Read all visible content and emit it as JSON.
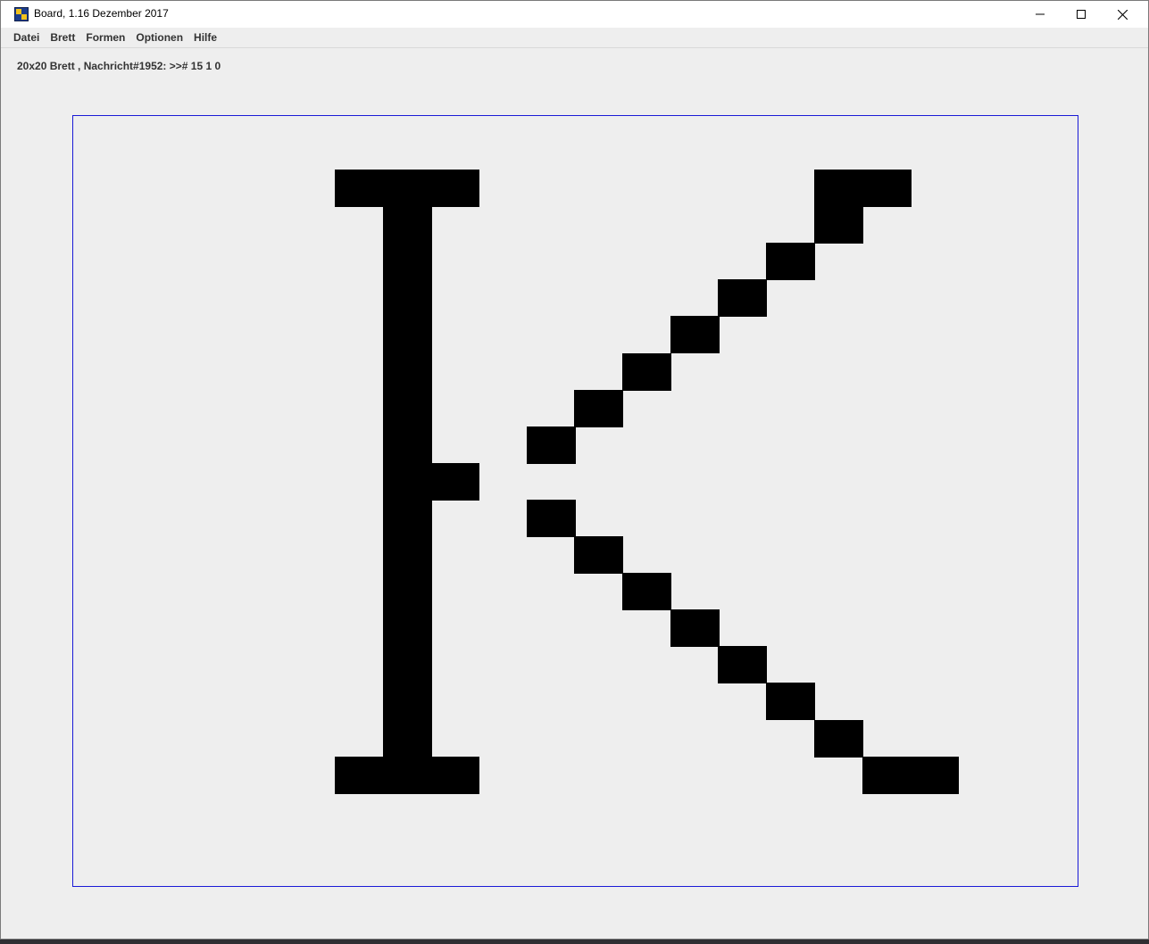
{
  "window": {
    "title": "Board, 1.16 Dezember 2017",
    "icon": "board-app-icon"
  },
  "menu": {
    "items": [
      "Datei",
      "Brett",
      "Formen",
      "Optionen",
      "Hilfe"
    ]
  },
  "status": {
    "text": "20x20 Brett , Nachricht#1952: >># 15 1 0"
  },
  "board": {
    "size": "20x20",
    "border_color": "#1a1ad6",
    "background_color": "#eeeeee",
    "filled_color": "#000000",
    "filled_cells": [
      [
        0,
        4
      ],
      [
        0,
        5
      ],
      [
        0,
        6
      ],
      [
        0,
        14
      ],
      [
        0,
        15
      ],
      [
        1,
        5
      ],
      [
        1,
        14
      ],
      [
        2,
        5
      ],
      [
        2,
        13
      ],
      [
        3,
        5
      ],
      [
        3,
        12
      ],
      [
        4,
        5
      ],
      [
        4,
        11
      ],
      [
        5,
        5
      ],
      [
        5,
        10
      ],
      [
        6,
        5
      ],
      [
        6,
        9
      ],
      [
        7,
        5
      ],
      [
        7,
        8
      ],
      [
        8,
        5
      ],
      [
        8,
        6
      ],
      [
        9,
        5
      ],
      [
        9,
        8
      ],
      [
        10,
        5
      ],
      [
        10,
        9
      ],
      [
        11,
        5
      ],
      [
        11,
        10
      ],
      [
        12,
        5
      ],
      [
        12,
        11
      ],
      [
        13,
        5
      ],
      [
        13,
        12
      ],
      [
        14,
        5
      ],
      [
        14,
        13
      ],
      [
        15,
        5
      ],
      [
        15,
        14
      ],
      [
        16,
        4
      ],
      [
        16,
        5
      ],
      [
        16,
        6
      ],
      [
        16,
        15
      ],
      [
        16,
        16
      ]
    ]
  }
}
